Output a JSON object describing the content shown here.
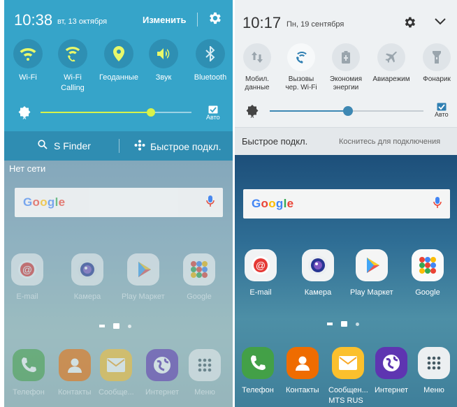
{
  "left": {
    "status": {
      "time": "10:38",
      "date": "вт, 13 октября",
      "edit_label": "Изменить"
    },
    "quick_settings": [
      {
        "label": "Wi-Fi",
        "icon": "wifi-icon"
      },
      {
        "label": "Wi-Fi Calling",
        "icon": "wifi-calling-icon"
      },
      {
        "label": "Геоданные",
        "icon": "location-icon"
      },
      {
        "label": "Звук",
        "icon": "sound-icon"
      },
      {
        "label": "Bluetooth",
        "icon": "bluetooth-icon"
      }
    ],
    "brightness": {
      "auto_label": "Авто",
      "level": 0.73,
      "auto_checked": true
    },
    "bottom_bar": {
      "sfinder_label": "S Finder",
      "quick_connect_label": "Быстрое подкл."
    },
    "no_network_label": "Нет сети",
    "search_brand": "Google",
    "apps_row1": [
      {
        "label": "E-mail",
        "icon": "email-icon",
        "color": "#e53935"
      },
      {
        "label": "Камера",
        "icon": "camera-icon",
        "color": "#3949ab"
      },
      {
        "label": "Play Маркет",
        "icon": "play-store-icon",
        "color": "#26a69a"
      },
      {
        "label": "Google",
        "icon": "google-folder-icon",
        "color": "#fbbc05"
      }
    ],
    "dock": [
      {
        "label": "Телефон",
        "icon": "phone-icon",
        "color": "#43a047"
      },
      {
        "label": "Контакты",
        "icon": "contacts-icon",
        "color": "#ef6c00"
      },
      {
        "label": "Сообще...",
        "icon": "messages-icon",
        "color": "#fbc02d"
      },
      {
        "label": "Интернет",
        "icon": "internet-icon",
        "color": "#5e35b1"
      },
      {
        "label": "Меню",
        "icon": "apps-menu-icon",
        "color": "#eceff1"
      }
    ]
  },
  "right": {
    "status": {
      "time": "10:17",
      "date": "Пн, 19 сентября"
    },
    "quick_settings": [
      {
        "label": "Мобил. данные",
        "icon": "mobile-data-icon"
      },
      {
        "label": "Вызовы чер. Wi-Fi",
        "icon": "wifi-calling-icon"
      },
      {
        "label": "Экономия энергии",
        "icon": "battery-saver-icon"
      },
      {
        "label": "Авиарежим",
        "icon": "airplane-icon"
      },
      {
        "label": "Фонарик",
        "icon": "flashlight-icon"
      }
    ],
    "brightness": {
      "auto_label": "Авто",
      "level": 0.51,
      "auto_checked": true
    },
    "quick_connect": {
      "title": "Быстрое подкл.",
      "hint": "Коснитесь для подключения"
    },
    "search_brand": "Google",
    "apps_row1": [
      {
        "label": "E-mail",
        "icon": "email-icon",
        "color": "#e53935"
      },
      {
        "label": "Камера",
        "icon": "camera-icon",
        "color": "#3949ab"
      },
      {
        "label": "Play Маркет",
        "icon": "play-store-icon",
        "color": "#26a69a"
      },
      {
        "label": "Google",
        "icon": "google-folder-icon",
        "color": "#fbbc05"
      }
    ],
    "dock": [
      {
        "label": "Телефон",
        "icon": "phone-icon",
        "color": "#43a047"
      },
      {
        "label": "Контакты",
        "icon": "contacts-icon",
        "color": "#ef6c00"
      },
      {
        "label": "Сообщен...",
        "icon": "messages-icon",
        "color": "#fbc02d"
      },
      {
        "label": "Интернет",
        "icon": "internet-icon",
        "color": "#5e35b1"
      },
      {
        "label": "Меню",
        "icon": "apps-menu-icon",
        "color": "#eceff1"
      }
    ],
    "carrier": "MTS RUS"
  },
  "colors": {
    "panel_left_accent": "#36a4c9",
    "slider_left": "#d7f24a",
    "slider_right": "#3e88b3"
  }
}
